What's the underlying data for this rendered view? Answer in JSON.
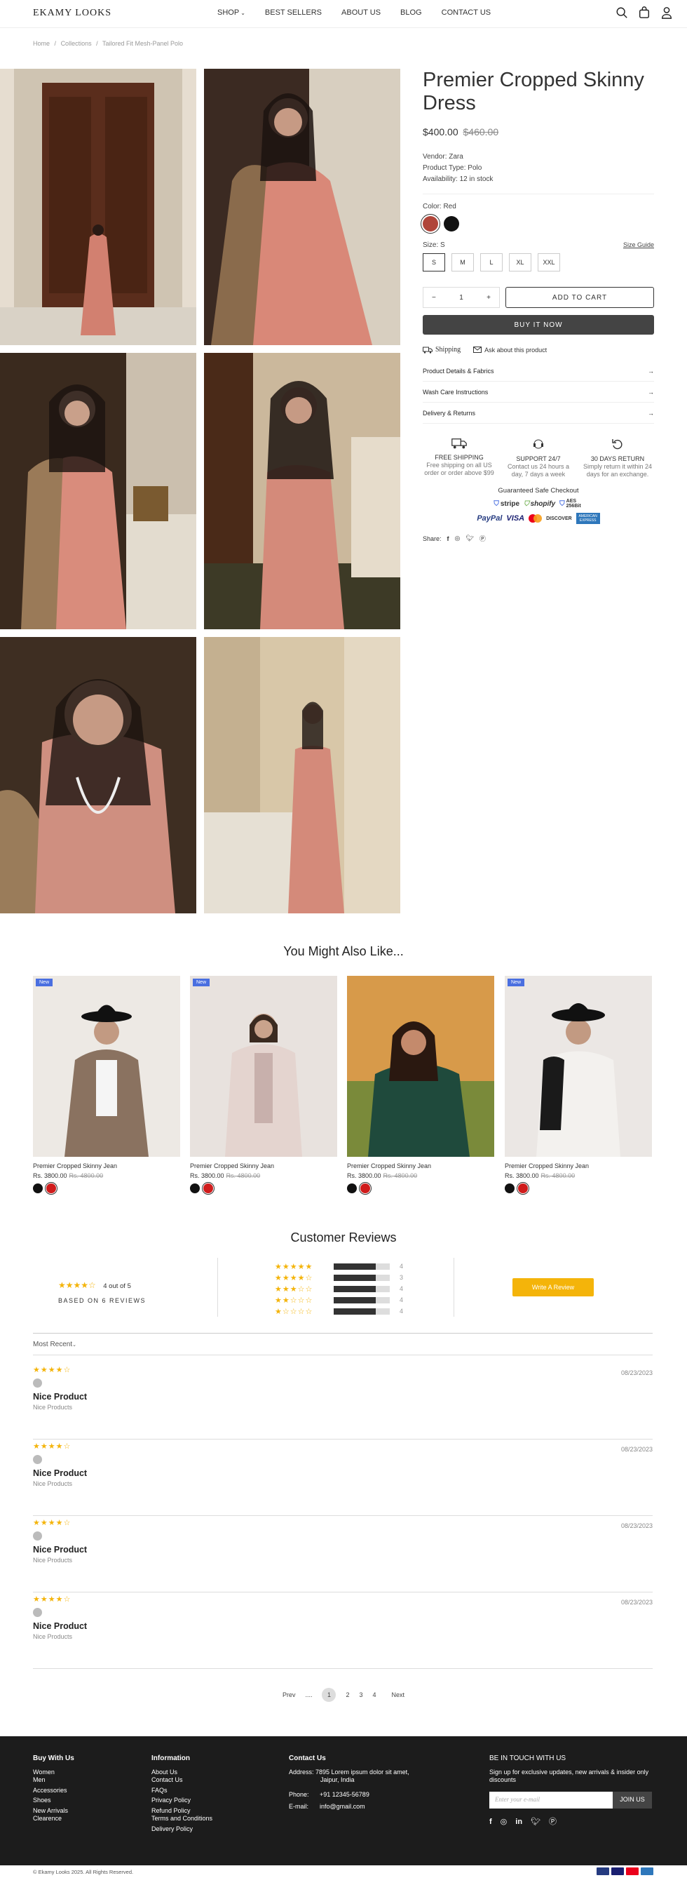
{
  "header": {
    "logo": "EKAMY LOOKS",
    "nav": [
      "SHOP",
      "BEST SELLERS",
      "ABOUT US",
      "BLOG",
      "CONTACT US"
    ]
  },
  "breadcrumb": [
    "Home",
    "/",
    "Collections",
    "/",
    "Tailored Fit Mesh-Panel Polo"
  ],
  "product": {
    "title": "Premier Cropped Skinny Dress",
    "price": "$400.00",
    "compare_price": "$460.00",
    "vendor": "Vendor: Zara",
    "type": "Product Type: Polo",
    "availability": "Availability: 12 in stock",
    "color_label": "Color: Red",
    "colors": [
      "#b0453a",
      "#111111"
    ],
    "size_label": "Size: S",
    "size_guide": "Size Guide",
    "sizes": [
      "S",
      "M",
      "L",
      "XL",
      "XXL"
    ],
    "qty": "1",
    "minus": "−",
    "plus": "+",
    "add_to_cart": "ADD TO CART",
    "buy_now": "BUY IT NOW",
    "shipping": "Shipping",
    "ask": "Ask about this product",
    "accordions": [
      "Product Details & Fabrics",
      "Wash Care Instructions",
      "Delivery & Returns"
    ],
    "features": [
      {
        "title": "FREE SHIPPING",
        "text": "Free shipping on all US order or order above $99"
      },
      {
        "title": "SUPPORT 24/7",
        "text": "Contact us 24 hours a day, 7 days a week"
      },
      {
        "title": "30 DAYS RETURN",
        "text": "Simply return it within 24 days for an exchange."
      }
    ],
    "safe_checkout": "Guaranteed Safe Checkout",
    "badges": [
      "stripe",
      "shopify",
      "AES 256Bit"
    ],
    "payments": [
      "PayPal",
      "VISA",
      "mastercard",
      "DISCOVER",
      "AMERICAN EXPRESS"
    ],
    "share_label": "Share:"
  },
  "related": {
    "heading": "You Might Also Like...",
    "new_tag": "New",
    "items": [
      {
        "name": "Premier Cropped Skinny Jean",
        "price": "Rs. 3800.00",
        "old": "Rs. 4800.00"
      },
      {
        "name": "Premier Cropped Skinny Jean",
        "price": "Rs. 3800.00",
        "old": "Rs. 4800.00"
      },
      {
        "name": "Premier Cropped Skinny Jean",
        "price": "Rs. 3800.00",
        "old": "Rs. 4800.00"
      },
      {
        "name": "Premier Cropped Skinny Jean",
        "price": "Rs. 3800.00",
        "old": "Rs. 4800.00"
      }
    ]
  },
  "reviews": {
    "heading": "Customer Reviews",
    "avg_stars": "★★★★☆",
    "avg_text": "4 out of 5",
    "based_on": "BASED ON 6 REVIEWS",
    "bars": [
      {
        "stars": "★★★★★",
        "fill": 0.75,
        "count": "4"
      },
      {
        "stars": "★★★★☆",
        "fill": 0.75,
        "count": "3"
      },
      {
        "stars": "★★★☆☆",
        "fill": 0.75,
        "count": "4"
      },
      {
        "stars": "★★☆☆☆",
        "fill": 0.75,
        "count": "4"
      },
      {
        "stars": "★☆☆☆☆",
        "fill": 0.75,
        "count": "4"
      }
    ],
    "write_btn": "Write A Review",
    "sort": "Most Recent",
    "items": [
      {
        "stars": "★★★★☆",
        "date": "08/23/2023",
        "title": "Nice Product",
        "body": "Nice Products"
      },
      {
        "stars": "★★★★☆",
        "date": "08/23/2023",
        "title": "Nice Product",
        "body": "Nice Products"
      },
      {
        "stars": "★★★★☆",
        "date": "08/23/2023",
        "title": "Nice Product",
        "body": "Nice Products"
      },
      {
        "stars": "★★★★☆",
        "date": "08/23/2023",
        "title": "Nice Product",
        "body": "Nice Products"
      }
    ]
  },
  "pager": {
    "prev": "Prev",
    "dots": "....",
    "pages": [
      "1",
      "2",
      "3",
      "4"
    ],
    "next": "Next"
  },
  "footer": {
    "col1": {
      "title": "Buy With Us",
      "links": [
        "Women",
        "Men",
        "Accessories",
        "Shoes",
        "New Arrivals",
        "Clearence"
      ]
    },
    "col2": {
      "title": "Information",
      "links": [
        "About Us",
        "Contact Us",
        "FAQs",
        "Privacy Policy",
        "Refund Policy",
        "Terms and Conditions",
        "Delivery Policy"
      ]
    },
    "col3": {
      "title": "Contact Us",
      "address": "Address: 7895 Lorem ipsum dolor sit amet,",
      "address2": "Jaipur, India",
      "phone_label": "Phone:",
      "phone": "+91 12345-56789",
      "email_label": "E-mail:",
      "email": "info@gmail.com"
    },
    "col4": {
      "title": "BE IN TOUCH WITH US",
      "text": "Sign up for exclusive updates, new arrivals & insider only discounts",
      "placeholder": "Enter your e-mail",
      "button": "JOIN US"
    },
    "copyright": "© Ekamy Looks 2025. All Rights Reserved."
  }
}
